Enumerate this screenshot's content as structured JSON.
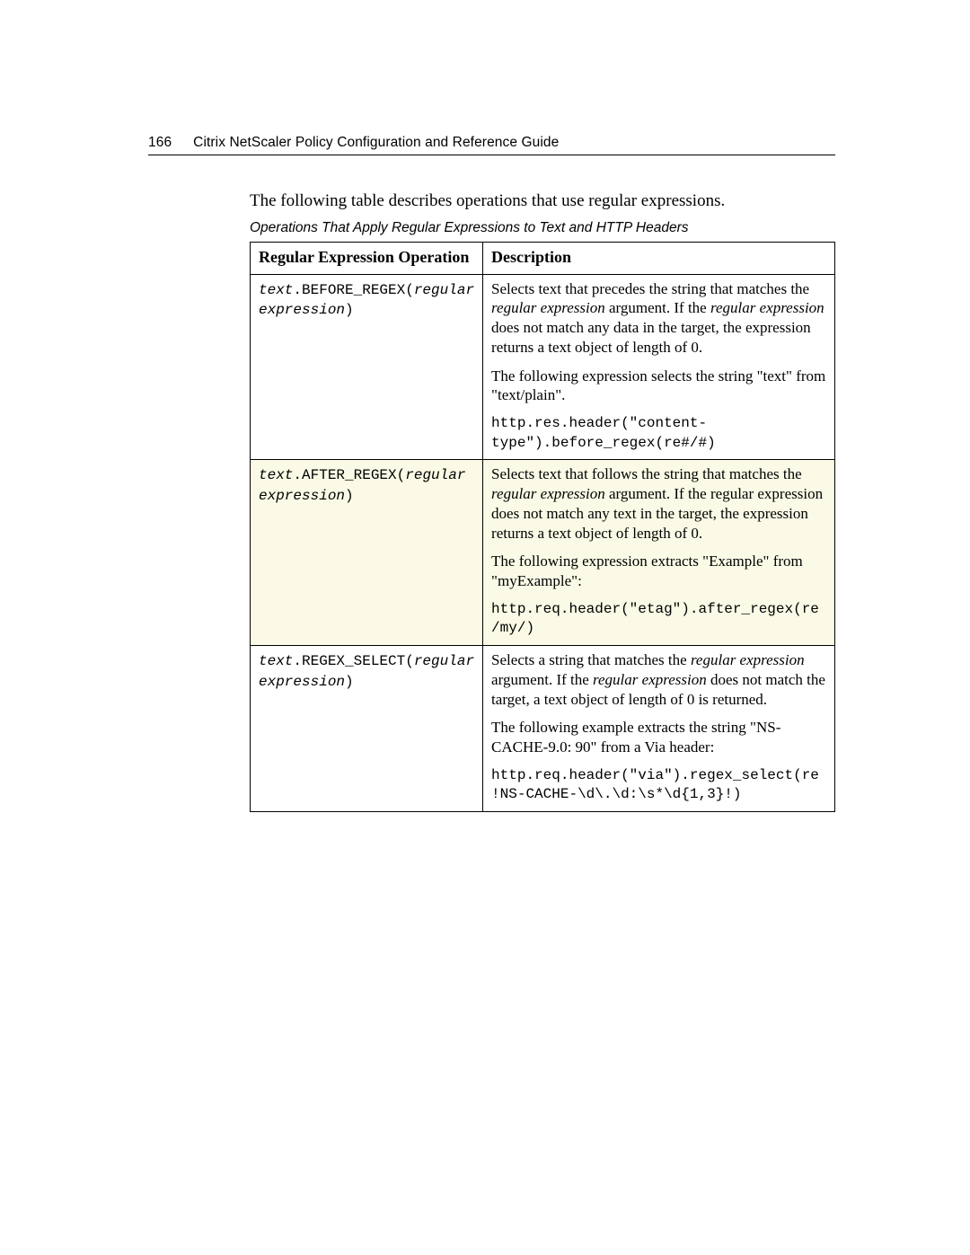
{
  "header": {
    "page_number": "166",
    "title": "Citrix NetScaler Policy Configuration and Reference Guide"
  },
  "intro_text": "The following table describes operations that use regular expressions.",
  "table_caption": "Operations That Apply Regular Expressions to Text and HTTP Headers",
  "table": {
    "headers": {
      "col1": "Regular Expression Operation",
      "col2": "Description"
    },
    "rows": [
      {
        "op_prefix": "text",
        "op_fn": ".BEFORE_REGEX(",
        "op_arg": "regular expression",
        "op_suffix": ")",
        "desc_p1_a": "Selects text that precedes the string that matches the ",
        "desc_p1_em1": "regular expression",
        "desc_p1_b": " argument. If the ",
        "desc_p1_em2": "regular expression",
        "desc_p1_c": " does not match any data in the target, the expression returns a text object of length of 0.",
        "desc_p2": "The following expression selects the string \"text\" from \"text/plain\".",
        "code": "http.res.header(\"content-type\").before_regex(re#/#)"
      },
      {
        "op_prefix": "text",
        "op_fn": ".AFTER_REGEX(",
        "op_arg": "regular expression",
        "op_suffix": ")",
        "desc_p1_a": "Selects text that follows the string that matches the ",
        "desc_p1_em1": "regular expression",
        "desc_p1_b": " argument. If the regular expression does not match any text in the target, the expression returns a text object of length of 0.",
        "desc_p1_em2": "",
        "desc_p1_c": "",
        "desc_p2": "The following expression extracts \"Example\" from \"myExample\":",
        "code": "http.req.header(\"etag\").after_regex(re/my/)"
      },
      {
        "op_prefix": "text",
        "op_fn": ".REGEX_SELECT(",
        "op_arg": "regular expression",
        "op_suffix": ")",
        "desc_p1_a": "Selects a string that matches the ",
        "desc_p1_em1": "regular expression",
        "desc_p1_b": " argument. If the ",
        "desc_p1_em2": "regular expression",
        "desc_p1_c": " does not match the target, a text object of length of 0 is returned.",
        "desc_p2": "The following example extracts the string \"NS-CACHE-9.0: 90\" from a Via header:",
        "code": "http.req.header(\"via\").regex_select(re!NS-CACHE-\\d\\.\\d:\\s*\\d{1,3}!)"
      }
    ]
  }
}
